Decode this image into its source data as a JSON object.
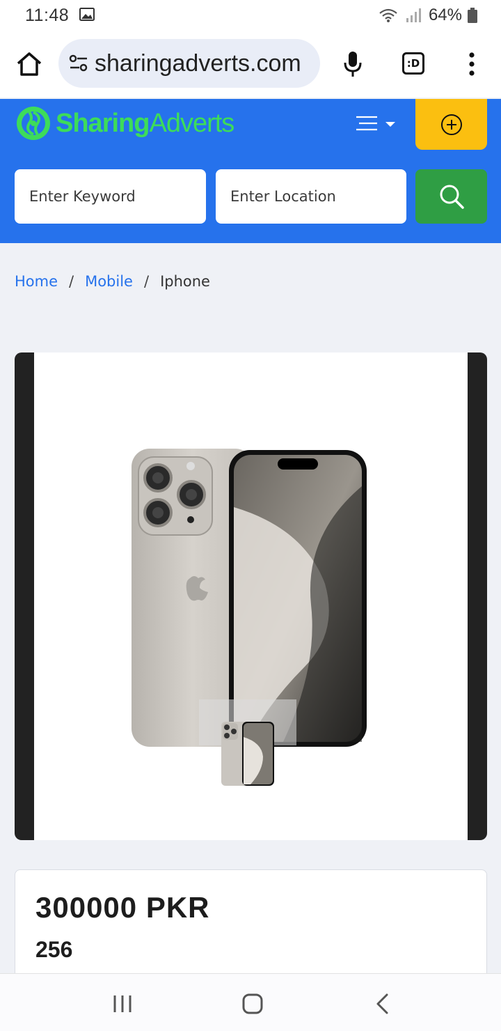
{
  "status_bar": {
    "time": "11:48",
    "battery": "64%"
  },
  "browser": {
    "url": "sharingadverts.com",
    "tabs_label": ":D"
  },
  "site": {
    "logo_part1": "Sharing",
    "logo_part2": "Adverts",
    "brand_color": "#2672ec",
    "accent_yellow": "#fbbf10",
    "accent_green": "#2f9e44",
    "search": {
      "keyword_placeholder": "Enter Keyword",
      "location_placeholder": "Enter Location"
    }
  },
  "breadcrumb": {
    "items": [
      "Home",
      "Mobile",
      "Iphone"
    ],
    "separator": "/"
  },
  "listing": {
    "price": "300000 PKR",
    "sub_value": "256"
  },
  "icons": {
    "home": "home-icon",
    "tune": "site-settings-icon",
    "mic": "mic-icon",
    "menu": "more-vert-icon",
    "post": "add-circle-icon",
    "search": "search-icon"
  }
}
